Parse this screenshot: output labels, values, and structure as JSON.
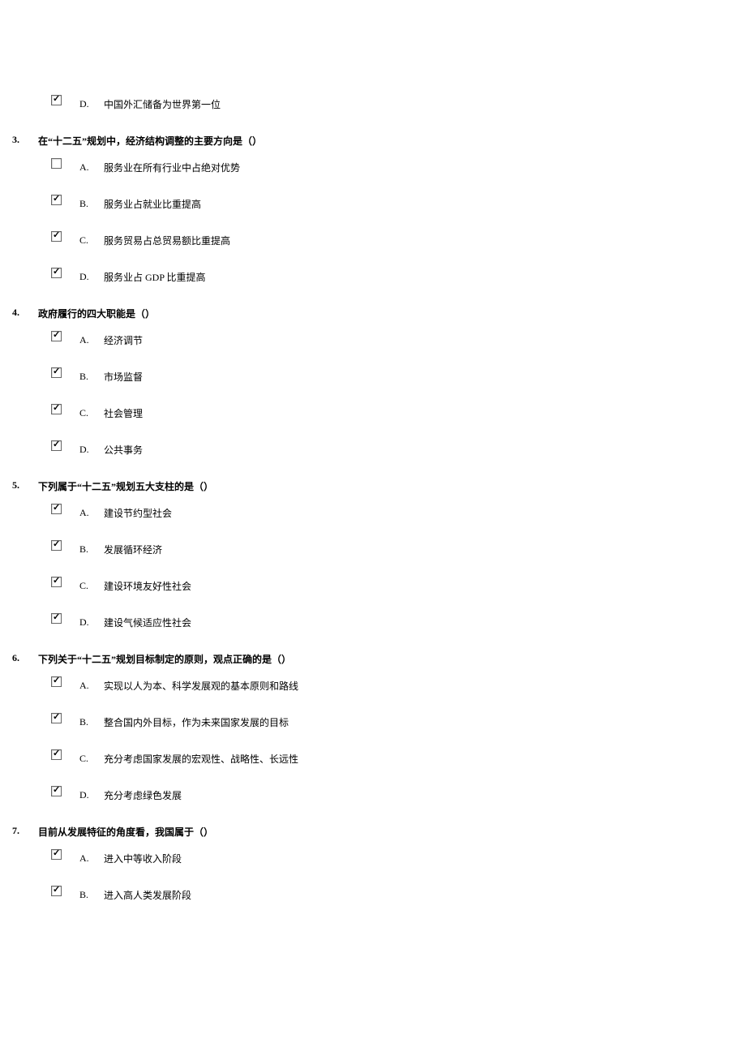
{
  "orphan": {
    "letter": "D.",
    "text": "中国外汇储备为世界第一位",
    "checked": true
  },
  "questions": [
    {
      "number": "3.",
      "text": "在“十二五”规划中，经济结构调整的主要方向是（）",
      "options": [
        {
          "letter": "A.",
          "text": "服务业在所有行业中占绝对优势",
          "checked": false
        },
        {
          "letter": "B.",
          "text": "服务业占就业比重提高",
          "checked": true
        },
        {
          "letter": "C.",
          "text": "服务贸易占总贸易额比重提高",
          "checked": true
        },
        {
          "letter": "D.",
          "text": "服务业占 GDP 比重提高",
          "checked": true
        }
      ]
    },
    {
      "number": "4.",
      "text": "政府履行的四大职能是（）",
      "options": [
        {
          "letter": "A.",
          "text": "经济调节",
          "checked": true
        },
        {
          "letter": "B.",
          "text": "市场监督",
          "checked": true
        },
        {
          "letter": "C.",
          "text": "社会管理",
          "checked": true
        },
        {
          "letter": "D.",
          "text": "公共事务",
          "checked": true
        }
      ]
    },
    {
      "number": "5.",
      "text": "下列属于“十二五”规划五大支柱的是（）",
      "options": [
        {
          "letter": "A.",
          "text": "建设节约型社会",
          "checked": true
        },
        {
          "letter": "B.",
          "text": "发展循环经济",
          "checked": true
        },
        {
          "letter": "C.",
          "text": "建设环境友好性社会",
          "checked": true
        },
        {
          "letter": "D.",
          "text": "建设气候适应性社会",
          "checked": true
        }
      ]
    },
    {
      "number": "6.",
      "text": "下列关于“十二五”规划目标制定的原则，观点正确的是（）",
      "options": [
        {
          "letter": "A.",
          "text": "实现以人为本、科学发展观的基本原则和路线",
          "checked": true
        },
        {
          "letter": "B.",
          "text": "整合国内外目标，作为未来国家发展的目标",
          "checked": true
        },
        {
          "letter": "C.",
          "text": "充分考虑国家发展的宏观性、战略性、长远性",
          "checked": true
        },
        {
          "letter": "D.",
          "text": "充分考虑绿色发展",
          "checked": true
        }
      ]
    },
    {
      "number": "7.",
      "text": "目前从发展特征的角度看，我国属于（）",
      "options": [
        {
          "letter": "A.",
          "text": "进入中等收入阶段",
          "checked": true
        },
        {
          "letter": "B.",
          "text": "进入高人类发展阶段",
          "checked": true
        }
      ]
    }
  ]
}
